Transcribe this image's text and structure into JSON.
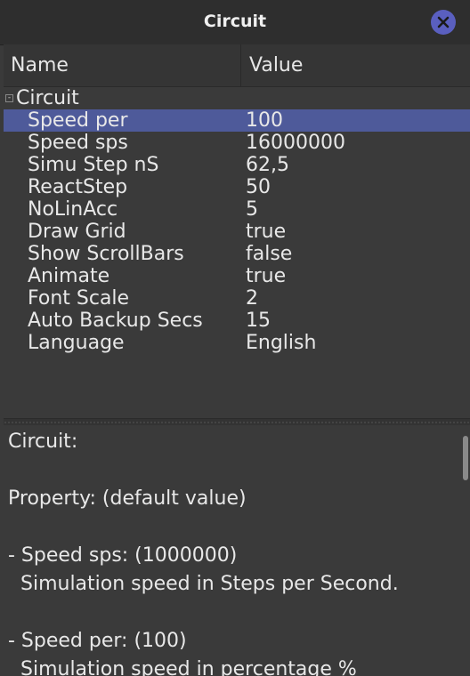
{
  "window": {
    "title": "Circuit"
  },
  "tree": {
    "headers": {
      "name": "Name",
      "value": "Value"
    },
    "group": {
      "label": "Circuit",
      "expander": "-"
    },
    "rows": [
      {
        "name": "Speed per",
        "value": "100"
      },
      {
        "name": "Speed sps",
        "value": "16000000"
      },
      {
        "name": "Simu Step nS",
        "value": "62,5"
      },
      {
        "name": "ReactStep",
        "value": "50"
      },
      {
        "name": "NoLinAcc",
        "value": "5"
      },
      {
        "name": "Draw Grid",
        "value": "true"
      },
      {
        "name": "Show ScrollBars",
        "value": "false"
      },
      {
        "name": "Animate",
        "value": "true"
      },
      {
        "name": "Font Scale",
        "value": "2"
      },
      {
        "name": "Auto Backup Secs",
        "value": "15"
      },
      {
        "name": "Language",
        "value": "English"
      }
    ]
  },
  "description": {
    "lines": [
      "Circuit:",
      "",
      "Property: (default value)",
      "",
      "- Speed sps: (1000000)",
      "  Simulation speed in Steps per Second.",
      "",
      "- Speed per: (100)",
      "  Simulation speed in percentage %"
    ]
  },
  "colors": {
    "selection": "#4e5a9a",
    "close_button": "#5a5fbf"
  }
}
